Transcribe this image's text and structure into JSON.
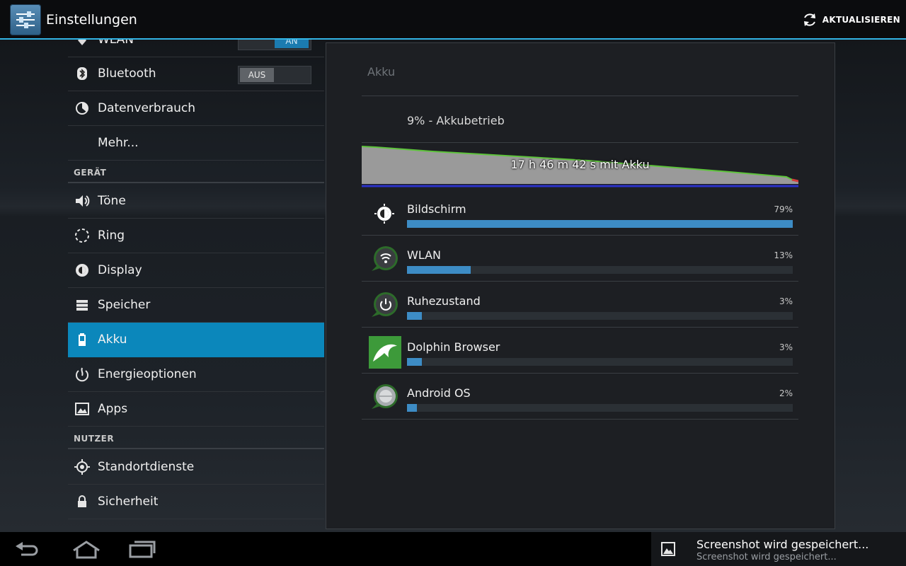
{
  "app": {
    "title": "Einstellungen",
    "refresh_label": "AKTUALISIEREN"
  },
  "left_list": {
    "wlan": {
      "label": "WLAN",
      "toggle": "AN"
    },
    "bluetooth": {
      "label": "Bluetooth",
      "toggle": "AUS"
    },
    "datenverbrauch": {
      "label": "Datenverbrauch"
    },
    "mehr": {
      "label": "Mehr..."
    },
    "section_geraet": "GERÄT",
    "toene": {
      "label": "Töne"
    },
    "ring": {
      "label": "Ring"
    },
    "display": {
      "label": "Display"
    },
    "speicher": {
      "label": "Speicher"
    },
    "akku": {
      "label": "Akku"
    },
    "energieoptionen": {
      "label": "Energieoptionen"
    },
    "apps": {
      "label": "Apps"
    },
    "section_nutzer": "NUTZER",
    "standortdienste": {
      "label": "Standortdienste"
    },
    "sicherheit": {
      "label": "Sicherheit"
    }
  },
  "panel": {
    "title": "Akku",
    "status": "9% - Akkubetrieb",
    "graph_label": "17 h 46 m 42 s mit Akku",
    "usage": [
      {
        "name": "Bildschirm",
        "percent_label": "79%",
        "percent": 79,
        "icon": "brightness-icon"
      },
      {
        "name": "WLAN",
        "percent_label": "13%",
        "percent": 13,
        "icon": "wifi-icon"
      },
      {
        "name": "Ruhezustand",
        "percent_label": "3%",
        "percent": 3,
        "icon": "power-icon"
      },
      {
        "name": "Dolphin Browser",
        "percent_label": "3%",
        "percent": 3,
        "icon": "dolphin-icon"
      },
      {
        "name": "Android OS",
        "percent_label": "2%",
        "percent": 2,
        "icon": "android-os-icon"
      }
    ]
  },
  "toast": {
    "title": "Screenshot wird gespeichert...",
    "subtitle": "Screenshot wird gespeichert..."
  },
  "colors": {
    "accent": "#33b5e5",
    "selected": "#0b87bb",
    "bar_fill": "#3d8cc5",
    "graph_line": "#5ec43c"
  }
}
